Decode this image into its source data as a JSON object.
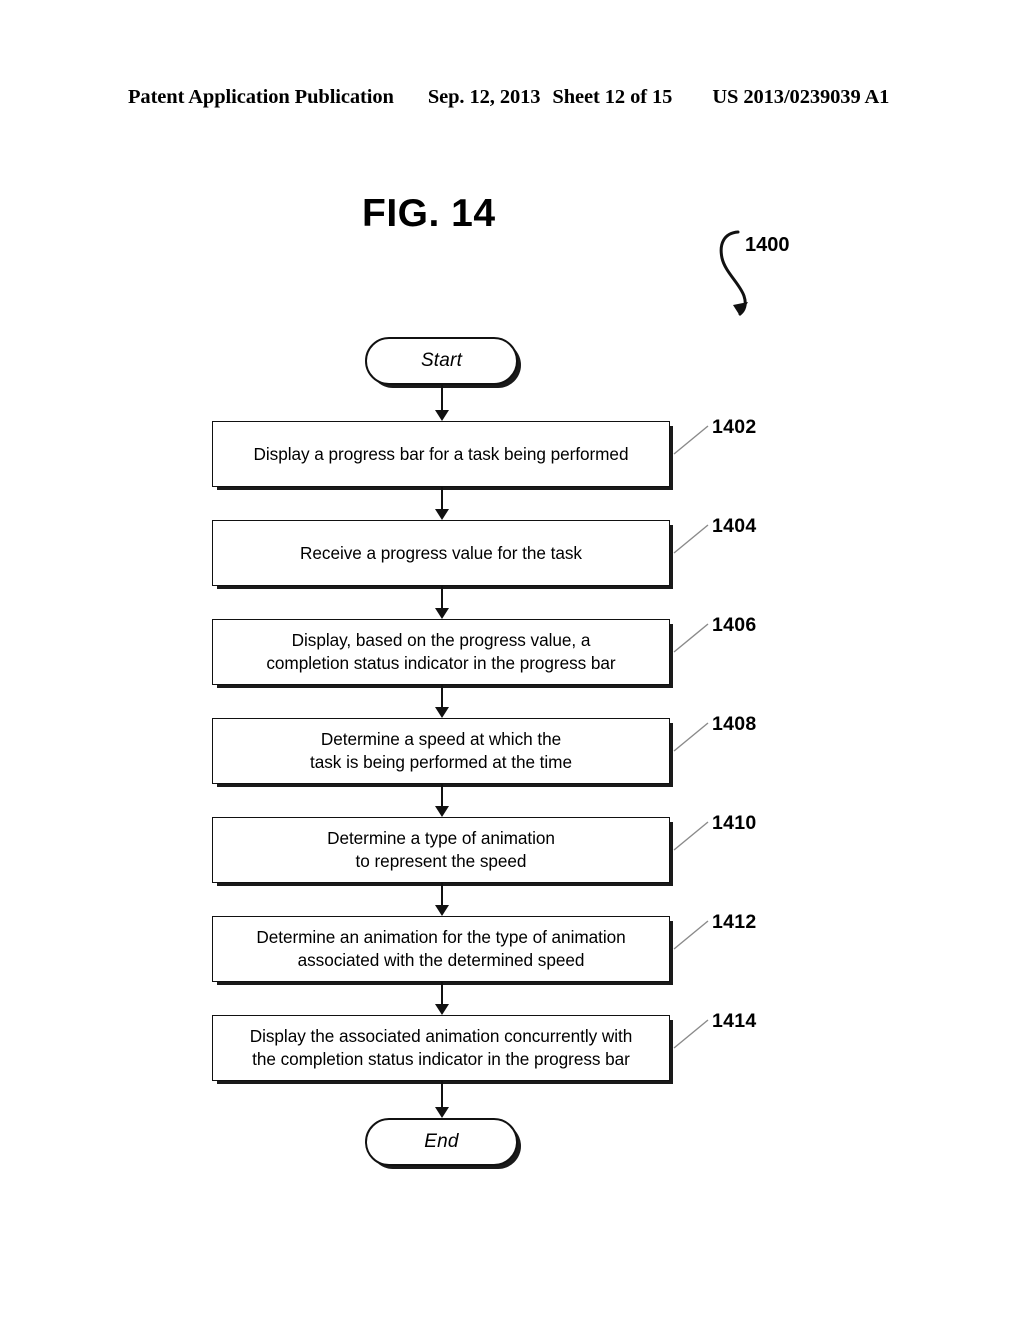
{
  "header": {
    "publication": "Patent Application Publication",
    "date": "Sep. 12, 2013",
    "sheet": "Sheet 12 of 15",
    "patent_number": "US 2013/0239039 A1"
  },
  "figure": {
    "title": "FIG. 14",
    "callout": "1400"
  },
  "flowchart": {
    "start": {
      "label": "Start"
    },
    "end": {
      "label": "End"
    },
    "steps": [
      {
        "ref": "1402",
        "text": "Display a progress bar for a task being performed"
      },
      {
        "ref": "1404",
        "text": "Receive a progress value for the task"
      },
      {
        "ref": "1406",
        "text": "Display, based on the progress value, a\ncompletion status indicator in the progress bar"
      },
      {
        "ref": "1408",
        "text": "Determine a speed at which the\ntask is being performed at the time"
      },
      {
        "ref": "1410",
        "text": "Determine a type of animation\nto represent the speed"
      },
      {
        "ref": "1412",
        "text": "Determine an animation for the type of animation\nassociated with the determined speed"
      },
      {
        "ref": "1414",
        "text": "Display the associated animation concurrently with\nthe completion status indicator in the progress bar"
      }
    ]
  },
  "colors": {
    "ink": "#111111",
    "shadow": "#1a1a1a",
    "paper": "#ffffff",
    "leader": "#8a8a8a"
  }
}
